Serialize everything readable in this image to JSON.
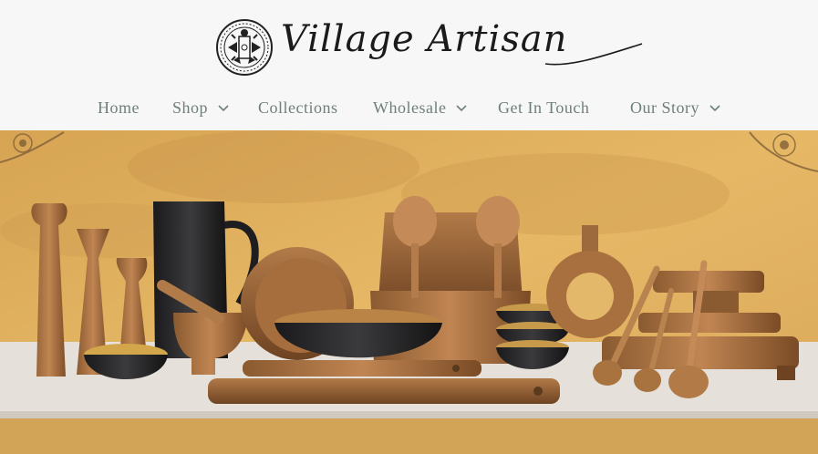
{
  "brand": {
    "name": "Village Artisan",
    "logo_icon": "tribal-emblem-icon"
  },
  "nav": {
    "items": [
      {
        "label": "Home",
        "has_dropdown": false
      },
      {
        "label": "Shop",
        "has_dropdown": true
      },
      {
        "label": "Collections",
        "has_dropdown": false
      },
      {
        "label": "Wholesale",
        "has_dropdown": true
      },
      {
        "label": "Get In Touch",
        "has_dropdown": false
      },
      {
        "label": "Our Story",
        "has_dropdown": true
      }
    ],
    "text_color": "#6e7f7a"
  },
  "hero": {
    "description_icon": "wooden-kitchenware-photo",
    "wall_color": "#d9a85a",
    "counter_color": "#e5e1da",
    "corner_ornament_icon": "mandala-ornament-icon"
  }
}
